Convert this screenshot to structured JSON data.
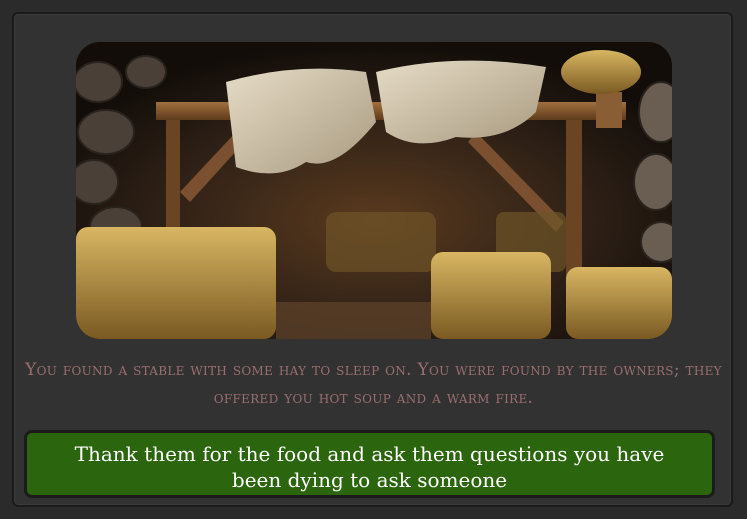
{
  "scene": {
    "image_alt": "stable-with-hay"
  },
  "narration": {
    "text": "You found a stable with some hay to sleep on. You were found by the owners; they offered you hot soup and a warm fire."
  },
  "choices": [
    {
      "label": "Thank them for the food and ask them questions you have been dying to ask someone"
    }
  ],
  "colors": {
    "background": "#2b2b2b",
    "panel": "#323232",
    "narration_text": "#9a6e70",
    "choice_button": "#2b650d",
    "choice_text": "#ffffff"
  }
}
